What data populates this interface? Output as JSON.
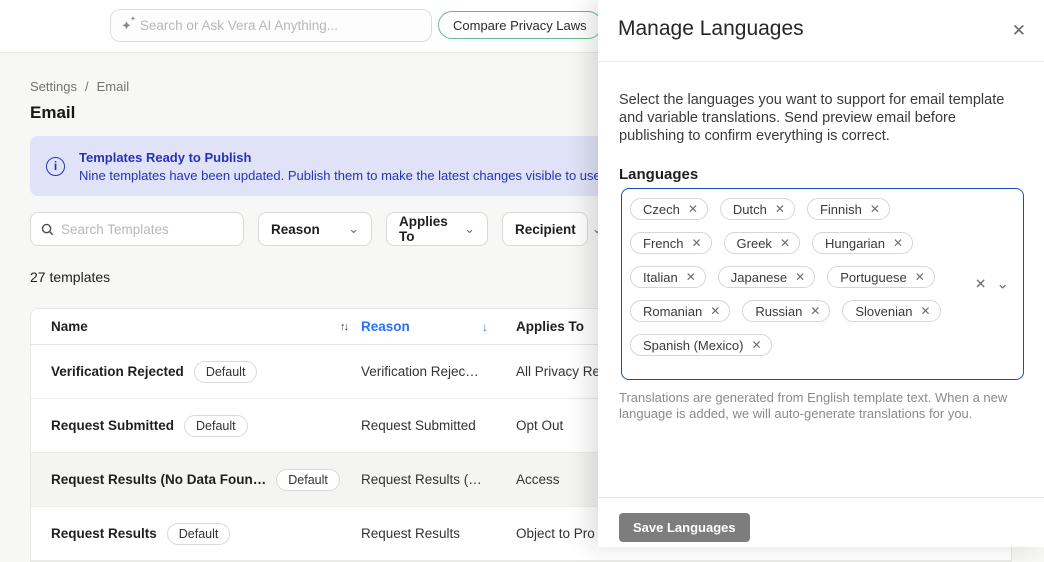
{
  "topbar": {
    "search_placeholder": "Search or Ask Vera AI Anything...",
    "compare_button": "Compare Privacy Laws"
  },
  "breadcrumb": {
    "items": [
      "Settings",
      "Email"
    ],
    "separator": "/"
  },
  "page": {
    "title": "Email"
  },
  "banner": {
    "title": "Templates Ready to Publish",
    "message": "Nine templates have been updated. Publish them to make the latest changes visible to use"
  },
  "filters": {
    "search_placeholder": "Search Templates",
    "dropdowns": [
      "Reason",
      "Applies To",
      "Recipient"
    ]
  },
  "summary": {
    "count_text": "27 templates"
  },
  "table": {
    "columns": [
      "Name",
      "Reason",
      "Applies To"
    ],
    "rows": [
      {
        "name": "Verification Rejected",
        "badge": "Default",
        "reason": "Verification Rejec…",
        "applies_to": "All Privacy Re"
      },
      {
        "name": "Request Submitted",
        "badge": "Default",
        "reason": "Request Submitted",
        "applies_to": "Opt Out"
      },
      {
        "name": "Request Results (No Data Foun…",
        "badge": "Default",
        "reason": "Request Results (…",
        "applies_to": "Access"
      },
      {
        "name": "Request Results",
        "badge": "Default",
        "reason": "Request Results",
        "applies_to": "Object to Pro"
      }
    ]
  },
  "panel": {
    "title": "Manage Languages",
    "description": "Select the languages you want to support for email template and variable translations. Send preview email before publishing to confirm everything is correct.",
    "languages_label": "Languages",
    "languages": [
      "Czech",
      "Dutch",
      "Finnish",
      "French",
      "Greek",
      "Hungarian",
      "Italian",
      "Japanese",
      "Portuguese",
      "Romanian",
      "Russian",
      "Slovenian",
      "Spanish (Mexico)"
    ],
    "helper_text": "Translations are generated from English template text. When a new language is added, we will auto-generate translations for you.",
    "save_button": "Save Languages"
  },
  "icons": {
    "sparkle": "✦",
    "close": "✕",
    "chevron": "⌄",
    "sort_both": "↑↓",
    "sort_desc": "↓",
    "info": "i",
    "clear": "✕"
  },
  "colors": {
    "focus_border": "#1B4AC9",
    "sort_active": "#2970FF",
    "banner_bg": "#E0E2F8",
    "banner_text": "#2633B8",
    "green_button_border": "#62BD92",
    "save_button_bg": "#7D7D7D"
  }
}
